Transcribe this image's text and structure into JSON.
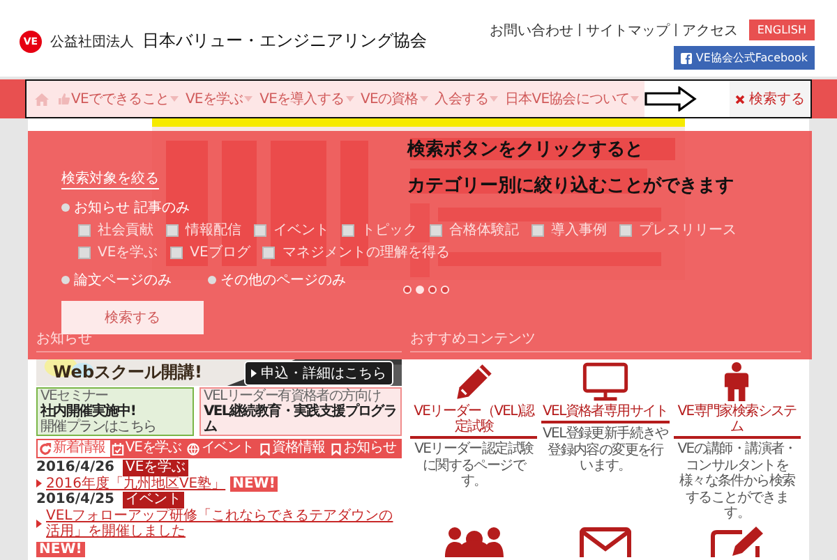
{
  "header": {
    "org_type": "公益社団法人",
    "org_name": "日本バリュー・エンジニアリング協会",
    "logo": "VE",
    "links": [
      "お問い合わせ",
      "サイトマップ",
      "アクセス"
    ],
    "english_button": "ENGLISH",
    "facebook_button": "VE協会公式Facebook"
  },
  "nav": {
    "items": [
      "VEでできること",
      "VEを学ぶ",
      "VEを導入する",
      "VEの資格",
      "入会する",
      "日本VE協会について"
    ],
    "search_toggle": "検索する"
  },
  "slider": {
    "dots": [
      {
        "selected": false
      },
      {
        "selected": true
      },
      {
        "selected": false
      },
      {
        "selected": false
      }
    ]
  },
  "search_panel": {
    "heading": "検索対象を絞る",
    "scopes": [
      {
        "label": "お知らせ 記事のみ",
        "selected": false
      },
      {
        "label": "論文ページのみ",
        "selected": false
      },
      {
        "label": "その他のページのみ",
        "selected": false
      }
    ],
    "categories": [
      {
        "label": "社会貢献",
        "checked": false
      },
      {
        "label": "情報配信",
        "checked": false
      },
      {
        "label": "イベント",
        "checked": false
      },
      {
        "label": "トピック",
        "checked": false
      },
      {
        "label": "合格体験記",
        "checked": false
      },
      {
        "label": "導入事例",
        "checked": false
      },
      {
        "label": "プレスリリース",
        "checked": false
      },
      {
        "label": "VEを学ぶ",
        "checked": false
      },
      {
        "label": "VEブログ",
        "checked": false
      },
      {
        "label": "マネジメントの理解を得る",
        "checked": false
      }
    ],
    "button": "検索する"
  },
  "hint": [
    "検索ボタンをクリックすると",
    "カテゴリー別に絞り込むことができます"
  ],
  "section_headings": [
    "お知らせ",
    "おすすめコンテンツ"
  ],
  "banner": {
    "title": "Webスクール開講!",
    "button": "申込・詳細はこちら"
  },
  "small_banners": [
    {
      "kicker": "VEセミナー",
      "title": "社内開催実施中!",
      "note": "開催プランはこちら",
      "color": "#7ab648"
    },
    {
      "kicker": "VELリーダー有資格者の方向け",
      "title": "VEL継続教育・実践支援プログラム",
      "color": "#f08c8c"
    }
  ],
  "news_tabs": [
    {
      "label": "新着情報",
      "selected": true
    },
    {
      "label": "VEを学ぶ",
      "selected": false
    },
    {
      "label": "イベント",
      "selected": false
    },
    {
      "label": "資格情報",
      "selected": false
    },
    {
      "label": "お知らせ",
      "selected": false
    }
  ],
  "news": [
    {
      "date": "2016/4/26",
      "tag": "VEを学ぶ",
      "title": "2016年度「九州地区VE塾」",
      "badge": "NEW!"
    },
    {
      "date": "2016/4/25",
      "tag": "イベント",
      "title": "VELフォローアップ研修「これならできるテアダウンの活用」を開催しました",
      "badge": "NEW!"
    }
  ],
  "contents": [
    {
      "title": "VEリーダー（VEL)認定試験",
      "description": "VEリーダー認定試験に関するページです。"
    },
    {
      "title": "VEL資格者専用サイト",
      "description": "VEL登録更新手続きや登録内容の変更を行います。"
    },
    {
      "title": "VE専門家検索システム",
      "description": "VEの講師・講演者・コンサルタントを様々な条件から検索することができます。"
    }
  ]
}
